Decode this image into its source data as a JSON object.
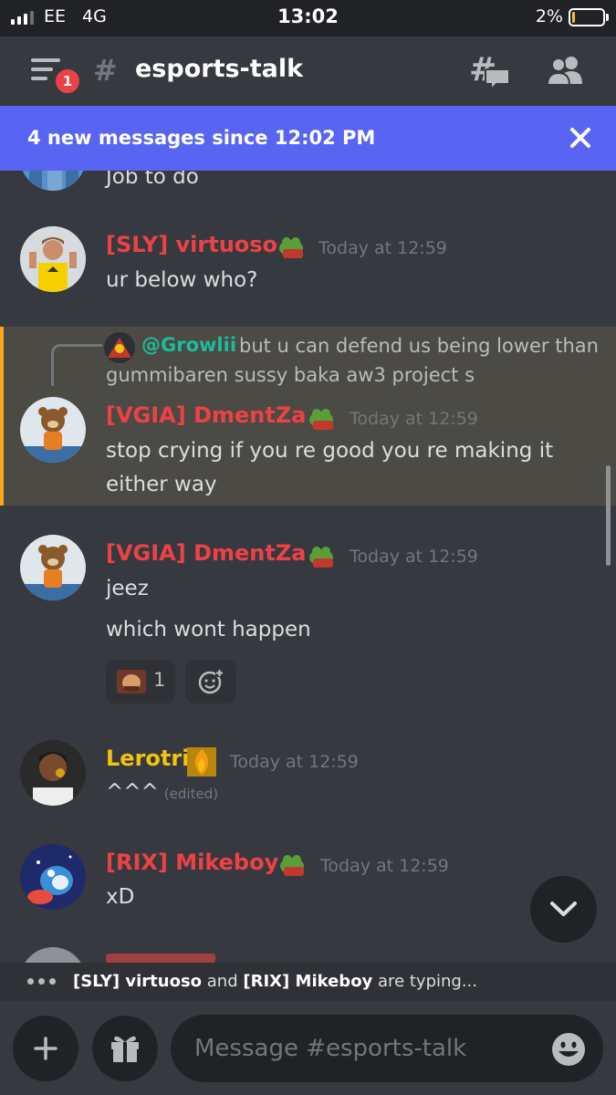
{
  "status_bar": {
    "carrier": "EE",
    "network": "4G",
    "time": "13:02",
    "battery_percent": "2%",
    "battery_level": 0.02
  },
  "header": {
    "notification_count": "1",
    "channel_name": "esports-talk"
  },
  "new_messages_banner": {
    "text": "4 new messages since 12:02 PM"
  },
  "messages": [
    {
      "text": "Job to do"
    },
    {
      "author": "[SLY] virtuoso",
      "author_color": "#ed4245",
      "timestamp": "Today at 12:59",
      "lines": [
        "ur below who?"
      ]
    },
    {
      "reply": {
        "mention": "@Growlii",
        "text_line1": "but u can defend us being lower than",
        "text_line2": "gummibaren sussy baka aw3 project s"
      },
      "author": "[VGIA] DmentZa",
      "author_color": "#ed4245",
      "timestamp": "Today at 12:59",
      "lines": [
        "stop crying if you re good you re making it",
        "either way"
      ]
    },
    {
      "author": "[VGIA] DmentZa",
      "author_color": "#ed4245",
      "timestamp": "Today at 12:59",
      "lines": [
        "jeez",
        "which wont happen"
      ],
      "reaction": {
        "emoji": "man-face-emoji",
        "count": "1"
      }
    },
    {
      "author": "Lerotri",
      "author_color": "#f1c40f",
      "timestamp": "Today at 12:59",
      "lines": [
        "^^^"
      ],
      "edited_label": "(edited)"
    },
    {
      "author": "[RIX] Mikeboy",
      "author_color": "#ed4245",
      "timestamp": "Today at 12:59",
      "lines": [
        "xD"
      ]
    }
  ],
  "typing": {
    "user1": "[SLY] virtuoso",
    "joiner": "and",
    "user2": "[RIX] Mikeboy",
    "suffix": "are typing..."
  },
  "composer": {
    "placeholder": "Message #esports-talk"
  },
  "icons": {
    "menu": "hamburger-menu-icon",
    "threads": "threads-icon",
    "members": "members-icon",
    "close": "close-icon",
    "add": "plus-icon",
    "gift": "gift-icon",
    "emoji": "emoji-smile-icon",
    "jump": "chevron-down-icon"
  },
  "colors": {
    "background": "#36393f",
    "blurple": "#5865f2",
    "mention": "#1abc9c",
    "highlight_bar": "#faa61a"
  }
}
